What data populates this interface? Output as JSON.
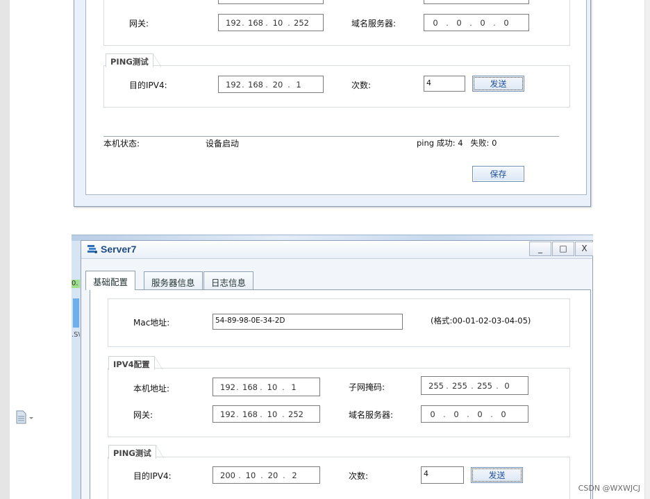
{
  "top_window": {
    "gateway_label": "网关:",
    "gateway_ip": [
      "192",
      "168",
      "10",
      "252"
    ],
    "dns_label": "域名服务器:",
    "dns_ip": [
      "0",
      "0",
      "0",
      "0"
    ],
    "ping_group_label": "PING测试",
    "dest_label": "目的IPV4:",
    "dest_ip": [
      "192",
      "168",
      "20",
      "1"
    ],
    "count_label": "次数:",
    "count_value": "4",
    "send_label": "发送",
    "status_label": "本机状态:",
    "status_value": "设备启动",
    "ping_result": "ping 成功: 4   失败: 0",
    "save_label": "保存"
  },
  "bottom_window": {
    "title": "Server7",
    "minimize": "_",
    "maximize": "□",
    "close": "X",
    "tabs": [
      {
        "label": "基础配置",
        "active": true
      },
      {
        "label": "服务器信息",
        "active": false
      },
      {
        "label": "日志信息",
        "active": false
      }
    ],
    "mac_label": "Mac地址:",
    "mac_value": "54-89-98-0E-34-2D",
    "mac_hint": "(格式:00-01-02-03-04-05)",
    "ipv4_group_label": "IPV4配置",
    "local_ip_label": "本机地址:",
    "local_ip": [
      "192",
      "168",
      "10",
      "1"
    ],
    "subnet_label": "子网掩码:",
    "subnet": [
      "255",
      "255",
      "255",
      "0"
    ],
    "gateway_label": "网关:",
    "gateway_ip": [
      "192",
      "168",
      "10",
      "252"
    ],
    "dns_label": "域名服务器:",
    "dns_ip": [
      "0",
      "0",
      "0",
      "0"
    ],
    "ping_group_label": "PING测试",
    "dest_label": "目的IPV4:",
    "dest_ip": [
      "200",
      "10",
      "20",
      "2"
    ],
    "count_label": "次数:",
    "count_value": "4",
    "send_label": "发送"
  },
  "doc_fragments": {
    "green_text": "0.",
    "side_text": ".S\\"
  },
  "watermark": "CSDN @WXWJCJ"
}
